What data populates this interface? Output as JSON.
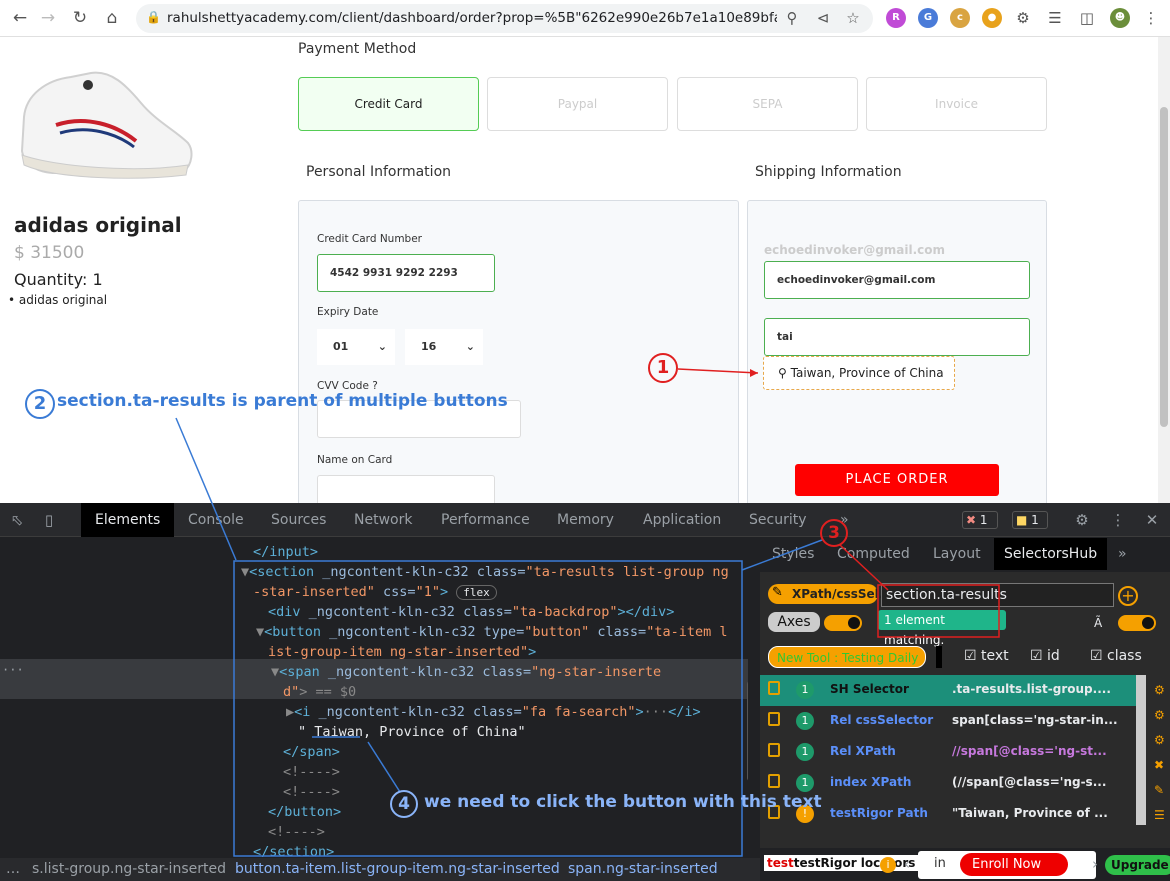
{
  "browser": {
    "url": "rahulshettyacademy.com/client/dashboard/order?prop=%5B\"6262e990e26b7e1a10e89bfa\"..."
  },
  "product": {
    "name": "adidas original",
    "price": "$ 31500",
    "quantity": "Quantity: 1",
    "bullet": "adidas original"
  },
  "payment": {
    "title": "Payment Method",
    "options": [
      "Credit Card",
      "Paypal",
      "SEPA",
      "Invoice"
    ]
  },
  "personal": {
    "title": "Personal Information",
    "cc_label": "Credit Card Number",
    "cc_value": "4542 9931 9292 2293",
    "expiry_label": "Expiry Date",
    "month": "01",
    "year": "16",
    "cvv_label": "CVV Code ?",
    "name_label": "Name on Card"
  },
  "shipping": {
    "title": "Shipping Information",
    "email_ghost": "echoedinvoker@gmail.com",
    "email_value": "echoedinvoker@gmail.com",
    "country_value": "tai",
    "suggestion": "Taiwan, Province of China",
    "place_order": "PLACE ORDER"
  },
  "devtools": {
    "tabs": [
      "Elements",
      "Console",
      "Sources",
      "Network",
      "Performance",
      "Memory",
      "Application",
      "Security"
    ],
    "more": "»",
    "errors": "1",
    "warnings": "1",
    "code": {
      "l1": "</input>",
      "l2a": "<section ",
      "l2b": "_ngcontent-kln-c32 class=",
      "l2c": "\"ta-results list-group ng",
      "l3a": "-star-inserted\"",
      "l3b": " css=",
      "l3c": "\"1\"",
      "l3d": ">",
      "flex": "flex",
      "l4a": "<div ",
      "l4b": "_ngcontent-kln-c32 class=",
      "l4c": "\"ta-backdrop\"",
      "l4d": "></div>",
      "l5a": "<button ",
      "l5b": "_ngcontent-kln-c32 type=",
      "l5c": "\"button\"",
      "l5d": " class=",
      "l5e": "\"ta-item l",
      "l6a": "ist-group-item ng-star-inserted\"",
      "l6b": ">",
      "l7a": "<span ",
      "l7b": "_ngcontent-kln-c32 class=",
      "l7c": "\"ng-star-inserte",
      "l8a": "d\"",
      "l8b": "> == $0",
      "l9a": "<i ",
      "l9b": "_ngcontent-kln-c32 class=",
      "l9c": "\"fa fa-search\"",
      "l9d": ">",
      "l9e": "</i>",
      "l10": "\" Taiwan, Province of China\"",
      "l11": "</span>",
      "l12": "<!---->",
      "l13": "<!---->",
      "l14": "</button>",
      "l15": "<!---->",
      "l16": "</section>"
    },
    "crumbs": [
      "s.list-group.ng-star-inserted",
      "button.ta-item.list-group-item.ng-star-inserted",
      "span.ng-star-inserted"
    ],
    "side_tabs": [
      "Styles",
      "Computed",
      "Layout",
      "SelectorsHub"
    ],
    "sh": {
      "xpath_btn": "XPath/cssSel..",
      "selector_input": "section.ta-results",
      "matching": "1 element matching.",
      "axes": "Axes",
      "new_tool": "New Tool : Testing Daily",
      "chk_text": "text",
      "chk_id": "id",
      "chk_class": "class",
      "rows": [
        {
          "n": "1",
          "k": "SH Selector",
          "v": ".ta-results.list-group...."
        },
        {
          "n": "1",
          "k": "Rel cssSelector",
          "v": "span[class='ng-star-in..."
        },
        {
          "n": "1",
          "k": "Rel XPath",
          "v": "//span[@class='ng-st..."
        },
        {
          "n": "1",
          "k": "index XPath",
          "v": "(//span[@class='ng-s..."
        },
        {
          "n": "!",
          "k": "testRigor Path",
          "v": "\"Taiwan, Province of ..."
        }
      ],
      "footer_brand": "testRigor locators",
      "footer_in": "in",
      "enroll": "Enroll Now",
      "upgrade": "Upgrade"
    }
  },
  "annotations": {
    "a1": "1",
    "a2": "2",
    "a2_text": "section.ta-results is parent of multiple buttons",
    "a3": "3",
    "a4": "4",
    "a4_text": "we need to click the button with this text"
  },
  "colors": {
    "annotation_blue": "#3a7bd5",
    "annotation_red": "#e02020",
    "place_order": "#ff0000",
    "selected_green": "#4caf50"
  }
}
